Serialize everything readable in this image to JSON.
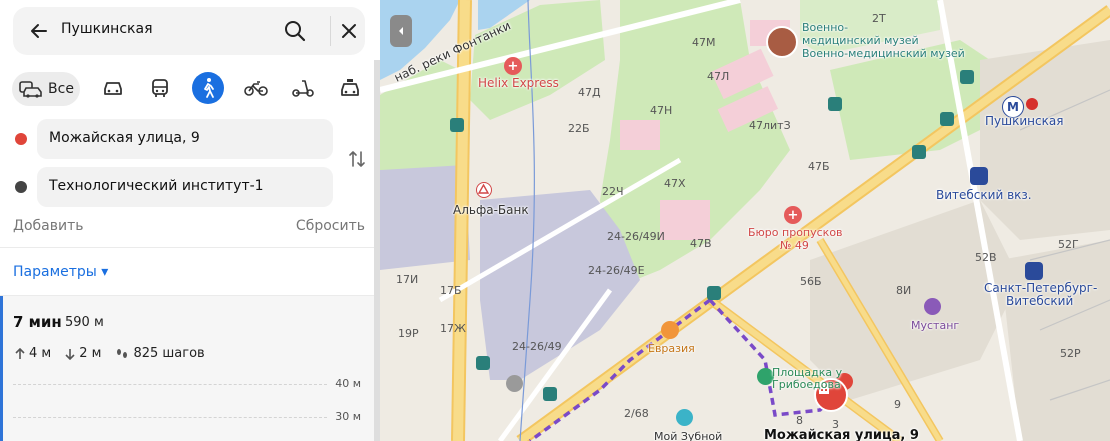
{
  "search": {
    "query": "Пушкинская"
  },
  "modes": [
    {
      "name": "all",
      "label": "Все"
    },
    {
      "name": "car"
    },
    {
      "name": "bus"
    },
    {
      "name": "pedestrian",
      "active": true
    },
    {
      "name": "bicycle"
    },
    {
      "name": "scooter"
    },
    {
      "name": "taxi"
    }
  ],
  "route": {
    "from": "Можайская улица, 9",
    "to": "Технологический институт-1",
    "add_label": "Добавить",
    "reset_label": "Сбросить",
    "params_label": "Параметры ▾"
  },
  "result": {
    "time": "7 мин",
    "distance": "590 м",
    "ascent": "4 м",
    "descent": "2 м",
    "steps": "825 шагов",
    "elevation_labels": [
      "40 м",
      "30 м"
    ]
  },
  "colors": {
    "accent": "#1a6fe0",
    "from_dot": "#e0453a",
    "to_dot": "#444444",
    "route_line": "#7a4ac8",
    "destination_pin": "#e0453a"
  },
  "map": {
    "streets": {
      "fontanka": "наб. реки Фонтанки"
    },
    "pois": {
      "helix": "Helix Express",
      "alfabank": "Альфа-Банк",
      "museum1": "Военно-",
      "museum1b": "медицинский музей",
      "museum2": "Военно-медицинский музей",
      "metro": "Пушкинская",
      "vitebsky": "Витебский вкз.",
      "spb_vitebsky1": "Санкт-Петербург-",
      "spb_vitebsky2": "Витебский",
      "byuro": "Бюро пропусков",
      "byuro2": "№ 49",
      "mustang": "Мустанг",
      "evrazia": "Евразия",
      "ploshchadka1": "Площадка у",
      "ploshchadka2": "Грибоедова",
      "zubnoy": "Мой Зубной",
      "destination": "Можайская улица, 9"
    },
    "building_numbers": [
      "2Т",
      "47М",
      "47Л",
      "47Д",
      "47Н",
      "22Б",
      "47литЗ",
      "47Б",
      "47Х",
      "22Ч",
      "24-26/49И",
      "47В",
      "24-26/49Е",
      "17И",
      "17Б",
      "56Б",
      "8И",
      "52В",
      "52Г",
      "52Р",
      "19Р",
      "17Ж",
      "24-26/49",
      "2/68",
      "8",
      "9",
      "3"
    ]
  }
}
